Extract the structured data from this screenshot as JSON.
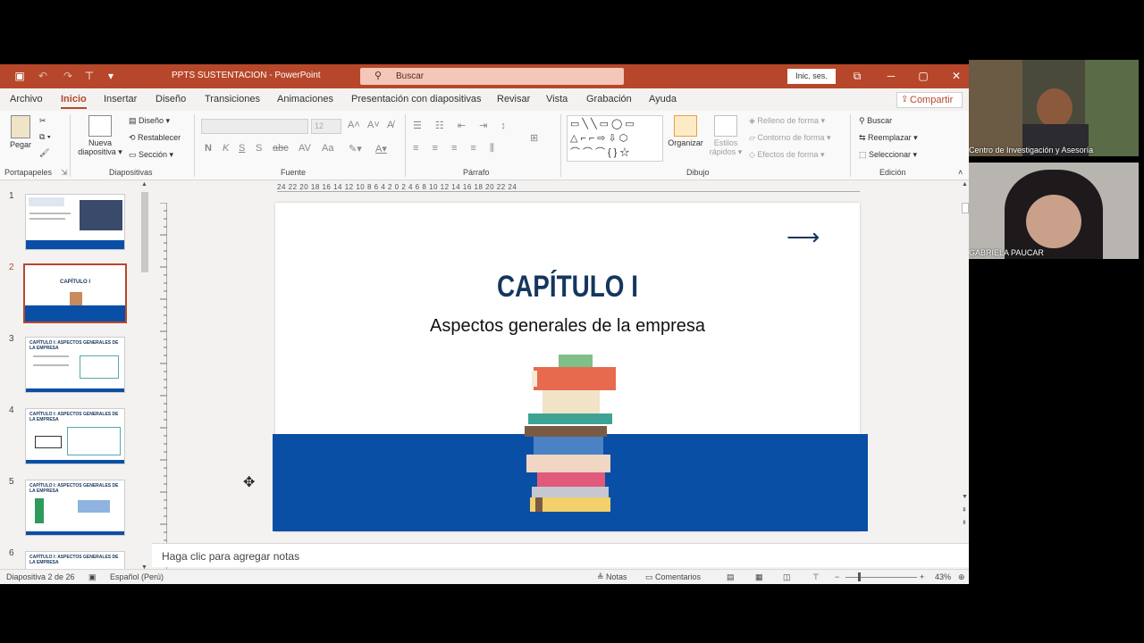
{
  "titlebar": {
    "doc_title": "PPTS SUSTENTACION",
    "app_name": "PowerPoint",
    "search_placeholder": "Buscar",
    "signin_label": "Inic. ses.",
    "accent_color": "#b7472a"
  },
  "tabs": [
    "Archivo",
    "Inicio",
    "Insertar",
    "Diseño",
    "Transiciones",
    "Animaciones",
    "Presentación con diapositivas",
    "Revisar",
    "Vista",
    "Grabación",
    "Ayuda"
  ],
  "active_tab": "Inicio",
  "share_label": "Compartir",
  "ribbon": {
    "paste_label": "Pegar",
    "new_slide_label": "Nueva",
    "new_slide_label2": "diapositiva",
    "layout_label": "Diseño",
    "reset_label": "Restablecer",
    "section_label": "Sección",
    "font_size": "12",
    "arrange_label": "Organizar",
    "quick_styles_label": "Estilos",
    "quick_styles_label2": "rápidos",
    "shape_fill": "Relleno de forma",
    "shape_outline": "Contorno de forma",
    "shape_effects": "Efectos de forma",
    "find_label": "Buscar",
    "replace_label": "Reemplazar",
    "select_label": "Seleccionar",
    "groups": {
      "clipboard": "Portapapeles",
      "slides": "Diapositivas",
      "font": "Fuente",
      "paragraph": "Párrafo",
      "drawing": "Dibujo",
      "editing": "Edición"
    }
  },
  "thumbnails": [
    {
      "num": "1",
      "title": ""
    },
    {
      "num": "2",
      "title": "CAPÍTULO I"
    },
    {
      "num": "3",
      "title": "CAPÍTULO I: ASPECTOS GENERALES DE LA EMPRESA"
    },
    {
      "num": "4",
      "title": "CAPÍTULO I: ASPECTOS GENERALES DE LA EMPRESA"
    },
    {
      "num": "5",
      "title": "CAPÍTULO I: ASPECTOS GENERALES DE LA EMPRESA"
    },
    {
      "num": "6",
      "title": "CAPÍTULO I: ASPECTOS GENERALES DE LA EMPRESA"
    }
  ],
  "selected_thumbnail": "2",
  "slide": {
    "title": "CAPÍTULO I",
    "subtitle": "Aspectos generales de la empresa",
    "band_color": "#0a4fa6",
    "title_color": "#15365e"
  },
  "ruler_text": "24 22 20 18 16 14 12 10 8 6 4 2 0 2 4 6 8 10 12 14 16 18 20 22 24",
  "notes_placeholder": "Haga clic para agregar notas",
  "status": {
    "slide_count": "Diapositiva 2 de 26",
    "language": "Español (Perú)",
    "notes_label": "Notas",
    "comments_label": "Comentarios",
    "zoom": "43%"
  },
  "participants": [
    {
      "name": "Centro de Investigación y Asesoría"
    },
    {
      "name": "GABRIELA PAUCAR"
    }
  ]
}
